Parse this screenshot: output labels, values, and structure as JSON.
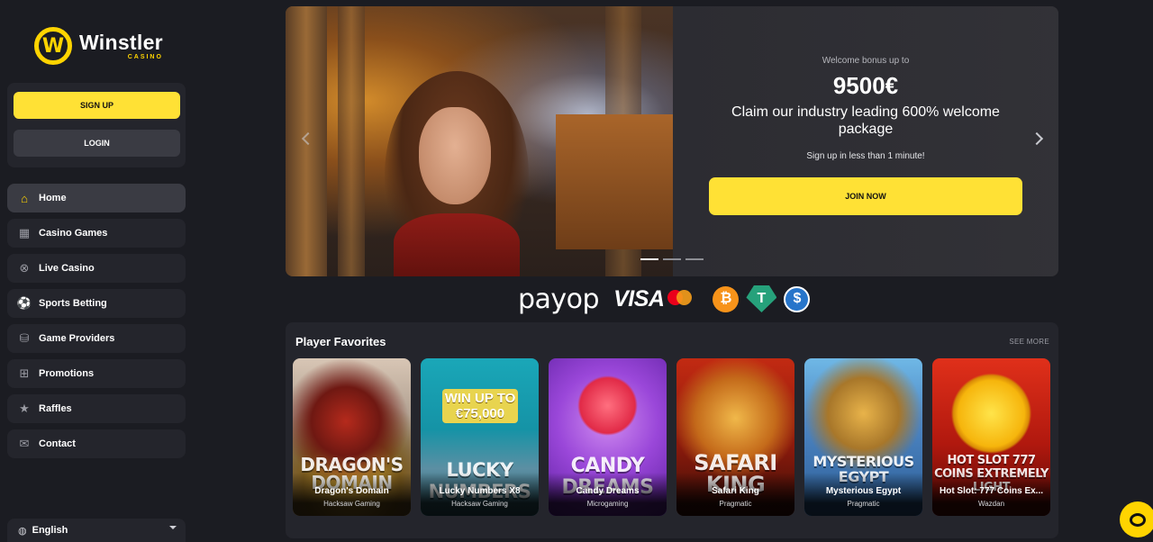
{
  "brand": {
    "name": "Winstler",
    "sub": "CASINO",
    "mark": "W"
  },
  "auth": {
    "signup": "SIGN UP",
    "login": "LOGIN"
  },
  "nav": [
    {
      "label": "Home",
      "icon": "home-icon",
      "glyph": "⌂"
    },
    {
      "label": "Casino Games",
      "icon": "slot-machine-icon",
      "glyph": "▦"
    },
    {
      "label": "Live Casino",
      "icon": "roulette-icon",
      "glyph": "⊗"
    },
    {
      "label": "Sports Betting",
      "icon": "soccer-ball-icon",
      "glyph": "⚽"
    },
    {
      "label": "Game Providers",
      "icon": "providers-icon",
      "glyph": "⛁"
    },
    {
      "label": "Promotions",
      "icon": "gift-icon",
      "glyph": "⊞"
    },
    {
      "label": "Raffles",
      "icon": "star-icon",
      "glyph": "★"
    },
    {
      "label": "Contact",
      "icon": "contact-icon",
      "glyph": "✉"
    }
  ],
  "language": {
    "selected": "English",
    "icon": "globe-icon",
    "glyph": "◍"
  },
  "hero": {
    "pre": "Welcome bonus up to",
    "amount": "9500€",
    "title": "Claim our industry leading 600% welcome package",
    "sub": "Sign up in less than 1 minute!",
    "cta": "JOIN NOW",
    "slides": 3,
    "active_slide": 0
  },
  "payments": {
    "payop": "payop",
    "visa": "VISA",
    "btc": "₿",
    "usdt": "T",
    "usdc": "$"
  },
  "favorites": {
    "title": "Player Favorites",
    "see_more": "SEE MORE",
    "games": [
      {
        "art": "DRAGON'S DOMAIN",
        "name": "Dragon's Domain",
        "provider": "Hacksaw Gaming"
      },
      {
        "art": "LUCKY NUMBERS",
        "name": "Lucky Numbers X8",
        "provider": "Hacksaw Gaming",
        "promo": "WIN UP TO €75,000"
      },
      {
        "art": "CANDY DREAMS",
        "name": "Candy Dreams",
        "provider": "Microgaming"
      },
      {
        "art": "SAFARI KING",
        "name": "Safari King",
        "provider": "Pragmatic"
      },
      {
        "art": "MYSTERIOUS EGYPT",
        "name": "Mysterious Egypt",
        "provider": "Pragmatic"
      },
      {
        "art": "HOT SLOT 777 COINS EXTREMELY LIGHT",
        "name": "Hot Slot: 777 Coins Ex...",
        "provider": "Wazdan"
      }
    ]
  },
  "colors": {
    "accent": "#ffe135",
    "bg": "#1b1c22",
    "panel": "#24252c",
    "active": "#3a3b43"
  }
}
